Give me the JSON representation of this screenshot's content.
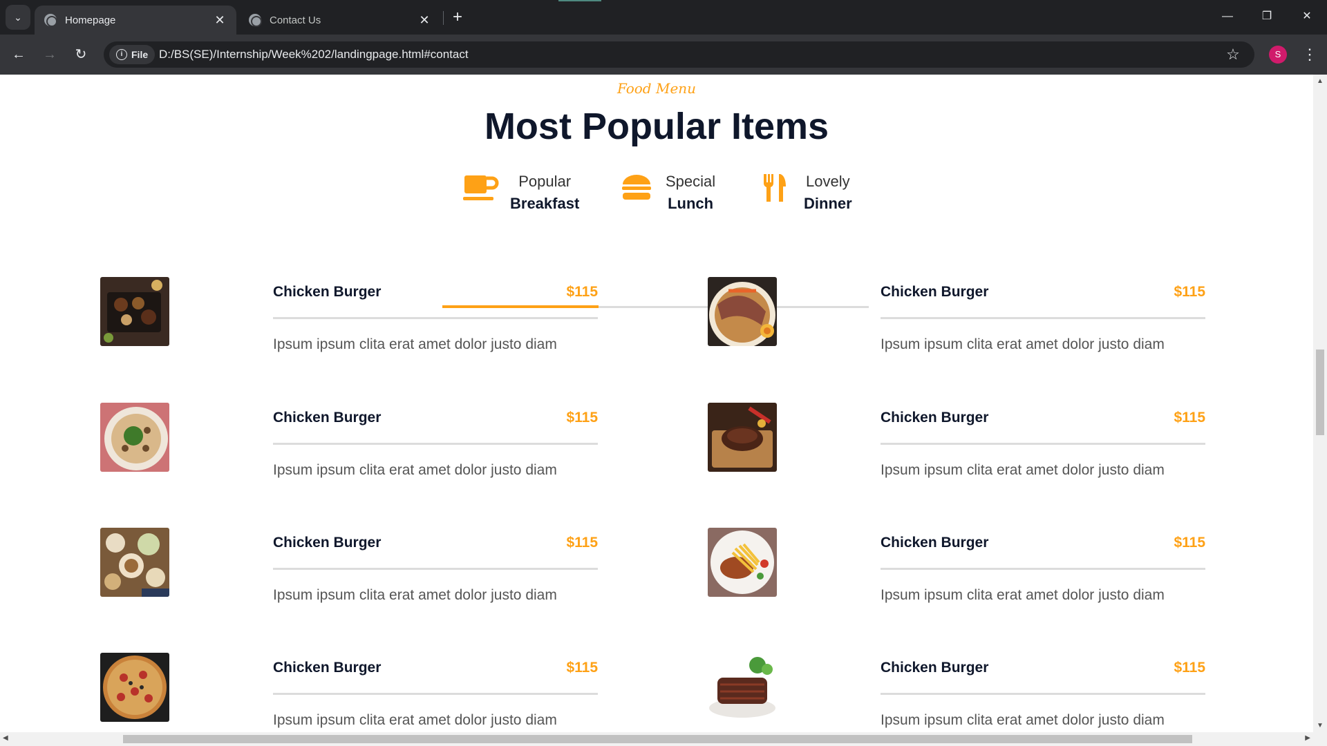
{
  "browser": {
    "tabs": [
      {
        "title": "Homepage",
        "active": true
      },
      {
        "title": "Contact Us",
        "active": false
      }
    ],
    "address": {
      "chip_label": "File",
      "url": "D:/BS(SE)/Internship/Week%202/landingpage.html#contact"
    },
    "profile_initial": "S"
  },
  "page": {
    "subtitle": "Food Menu",
    "heading": "Most Popular Items",
    "menu_tabs": [
      {
        "small": "Popular",
        "big": "Breakfast",
        "icon": "coffee-cup-icon",
        "active": true
      },
      {
        "small": "Special",
        "big": "Lunch",
        "icon": "hamburger-icon",
        "active": false
      },
      {
        "small": "Lovely",
        "big": "Dinner",
        "icon": "utensils-icon",
        "active": false
      }
    ],
    "items": [
      {
        "name": "Chicken Burger",
        "price": "$115",
        "desc": "Ipsum ipsum clita erat amet dolor justo diam",
        "image": "platter"
      },
      {
        "name": "Chicken Burger",
        "price": "$115",
        "desc": "Ipsum ipsum clita erat amet dolor justo diam",
        "image": "ramen"
      },
      {
        "name": "Chicken Burger",
        "price": "$115",
        "desc": "Ipsum ipsum clita erat amet dolor justo diam",
        "image": "salad-plate"
      },
      {
        "name": "Chicken Burger",
        "price": "$115",
        "desc": "Ipsum ipsum clita erat amet dolor justo diam",
        "image": "steak"
      },
      {
        "name": "Chicken Burger",
        "price": "$115",
        "desc": "Ipsum ipsum clita erat amet dolor justo diam",
        "image": "table-spread"
      },
      {
        "name": "Chicken Burger",
        "price": "$115",
        "desc": "Ipsum ipsum clita erat amet dolor justo diam",
        "image": "fries-plate"
      },
      {
        "name": "Chicken Burger",
        "price": "$115",
        "desc": "Ipsum ipsum clita erat amet dolor justo diam",
        "image": "pizza"
      },
      {
        "name": "Chicken Burger",
        "price": "$115",
        "desc": "Ipsum ipsum clita erat amet dolor justo diam",
        "image": "grilled-meat"
      }
    ]
  },
  "colors": {
    "accent": "#fea116",
    "dark": "#0f172b"
  }
}
